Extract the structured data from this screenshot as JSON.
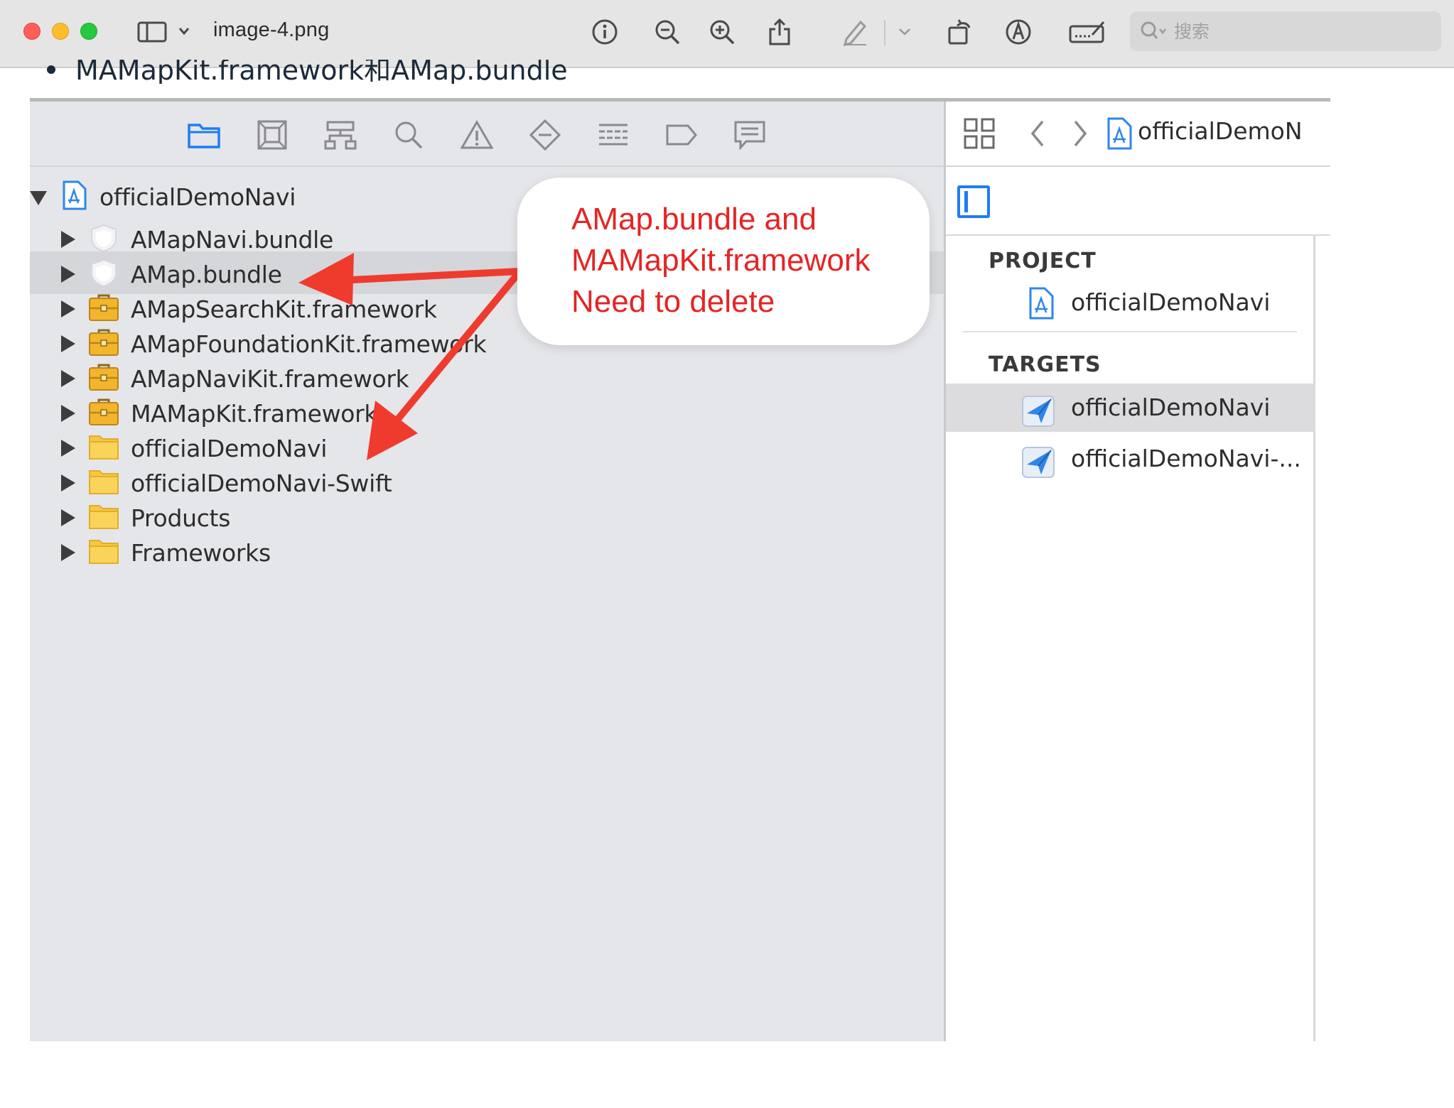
{
  "window": {
    "title": "image-4.png",
    "search_placeholder": "搜索"
  },
  "doc": {
    "bullet_text": "MAMapKit.framework和AMap.bundle"
  },
  "navigator": {
    "root": "officialDemoNavi",
    "items": [
      {
        "label": "AMapNavi.bundle",
        "icon": "bundle-icon"
      },
      {
        "label": "AMap.bundle",
        "icon": "bundle-icon",
        "selected": true
      },
      {
        "label": "AMapSearchKit.framework",
        "icon": "framework-icon"
      },
      {
        "label": "AMapFoundationKit.framework",
        "icon": "framework-icon"
      },
      {
        "label": "AMapNaviKit.framework",
        "icon": "framework-icon"
      },
      {
        "label": "MAMapKit.framework",
        "icon": "framework-icon"
      },
      {
        "label": "officialDemoNavi",
        "icon": "folder-icon"
      },
      {
        "label": "officialDemoNavi-Swift",
        "icon": "folder-icon"
      },
      {
        "label": "Products",
        "icon": "folder-icon"
      },
      {
        "label": "Frameworks",
        "icon": "folder-icon"
      }
    ]
  },
  "project_pane": {
    "breadcrumb": "officialDemoN",
    "project_header": "PROJECT",
    "project_item": "officialDemoNavi",
    "targets_header": "TARGETS",
    "targets": [
      "officialDemoNavi",
      "officialDemoNavi-..."
    ]
  },
  "annotation": {
    "text": "AMap.bundle and\nMAMapKit.framework\nNeed to delete",
    "color": "#e42525"
  },
  "colors": {
    "accent": "#1f7cf4",
    "annotation_red": "#e42525"
  }
}
